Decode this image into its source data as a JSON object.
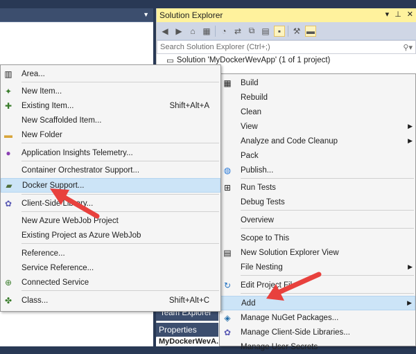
{
  "solution_explorer": {
    "title": "Solution Explorer",
    "pin_icon": "pin-icon",
    "close_icon": "close-icon",
    "search_placeholder": "Search Solution Explorer (Ctrl+;)",
    "tree": [
      {
        "label": "Solution 'MyDockerWevApp' (1 of 1 project)"
      }
    ]
  },
  "bottom": {
    "team_explorer": "Team Explorer",
    "properties": "Properties",
    "properties_value": "MyDockerWevA..."
  },
  "left_menu": {
    "items": [
      {
        "label": "Area...",
        "shortcut": "",
        "icon": "area-icon"
      },
      {
        "label": "New Item...",
        "shortcut": "",
        "icon": "new-item-icon"
      },
      {
        "label": "Existing Item...",
        "shortcut": "Shift+Alt+A",
        "icon": "existing-item-icon"
      },
      {
        "label": "New Scaffolded Item...",
        "shortcut": "",
        "icon": ""
      },
      {
        "label": "New Folder",
        "shortcut": "",
        "icon": "folder-icon"
      },
      {
        "label": "Application Insights Telemetry...",
        "shortcut": "",
        "icon": "insights-icon"
      },
      {
        "label": "Container Orchestrator Support...",
        "shortcut": "",
        "icon": ""
      },
      {
        "label": "Docker Support...",
        "shortcut": "",
        "icon": "docker-icon"
      },
      {
        "label": "Client-Side Library...",
        "shortcut": "",
        "icon": "library-icon"
      },
      {
        "label": "New Azure WebJob Project",
        "shortcut": "",
        "icon": ""
      },
      {
        "label": "Existing Project as Azure WebJob",
        "shortcut": "",
        "icon": ""
      },
      {
        "label": "Reference...",
        "shortcut": "",
        "icon": ""
      },
      {
        "label": "Service Reference...",
        "shortcut": "",
        "icon": ""
      },
      {
        "label": "Connected Service",
        "shortcut": "",
        "icon": "connected-service-icon"
      },
      {
        "label": "Class...",
        "shortcut": "Shift+Alt+C",
        "icon": "class-icon"
      }
    ]
  },
  "right_menu": {
    "items": [
      {
        "label": "Build",
        "icon": "build-icon"
      },
      {
        "label": "Rebuild",
        "icon": ""
      },
      {
        "label": "Clean",
        "icon": ""
      },
      {
        "label": "View",
        "icon": "",
        "submenu": true
      },
      {
        "label": "Analyze and Code Cleanup",
        "icon": "",
        "submenu": true
      },
      {
        "label": "Pack",
        "icon": ""
      },
      {
        "label": "Publish...",
        "icon": "publish-icon"
      },
      {
        "label": "Run Tests",
        "icon": "run-tests-icon"
      },
      {
        "label": "Debug Tests",
        "icon": ""
      },
      {
        "label": "Overview",
        "icon": ""
      },
      {
        "label": "Scope to This",
        "icon": ""
      },
      {
        "label": "New Solution Explorer View",
        "icon": "new-view-icon"
      },
      {
        "label": "File Nesting",
        "icon": "",
        "submenu": true
      },
      {
        "label": "Edit Project File",
        "icon": "edit-icon"
      },
      {
        "label": "Add",
        "icon": "",
        "submenu": true
      },
      {
        "label": "Manage NuGet Packages...",
        "icon": "nuget-icon"
      },
      {
        "label": "Manage Client-Side Libraries...",
        "icon": "library-icon"
      },
      {
        "label": "Manage User Secrets",
        "icon": ""
      }
    ]
  },
  "colors": {
    "title_accent": "#fff29d",
    "highlight": "#cce4f7",
    "arrow": "#e8413d",
    "chrome_dark": "#293955"
  }
}
